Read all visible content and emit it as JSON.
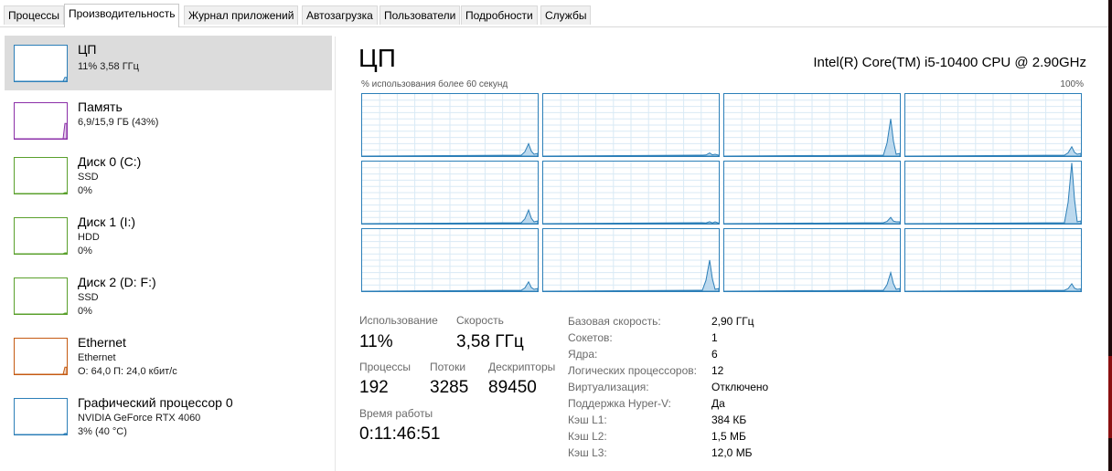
{
  "tabs": [
    "Процессы",
    "Производительность",
    "Журнал приложений",
    "Автозагрузка",
    "Пользователи",
    "Подробности",
    "Службы"
  ],
  "active_tab": "Производительность",
  "sidebar": {
    "items": [
      {
        "title": "ЦП",
        "lines": [
          "11% 3,58 ГГц"
        ],
        "color": "#2c7fb8",
        "level": 0.11
      },
      {
        "title": "Память",
        "lines": [
          "6,9/15,9 ГБ (43%)"
        ],
        "color": "#8b2fa8",
        "level": 0.43
      },
      {
        "title": "Диск 0 (C:)",
        "lines": [
          "SSD",
          "0%"
        ],
        "color": "#5aa02c",
        "level": 0
      },
      {
        "title": "Диск 1 (I:)",
        "lines": [
          "HDD",
          "0%"
        ],
        "color": "#5aa02c",
        "level": 0
      },
      {
        "title": "Диск 2 (D: F:)",
        "lines": [
          "SSD",
          "0%"
        ],
        "color": "#5aa02c",
        "level": 0
      },
      {
        "title": "Ethernet",
        "lines": [
          "Ethernet",
          "О: 64,0 П: 24,0 кбит/с"
        ],
        "color": "#c55a11",
        "level": 0.2
      },
      {
        "title": "Графический процессор 0",
        "lines": [
          "NVIDIA GeForce RTX 4060",
          "3% (40 °C)"
        ],
        "color": "#2c7fb8",
        "level": 0.03
      }
    ]
  },
  "main": {
    "title": "ЦП",
    "cpu_model": "Intel(R) Core(TM) i5-10400 CPU @ 2.90GHz",
    "graph_label": "% использования более 60 секунд",
    "graph_max": "100%",
    "core_peaks": [
      0.2,
      0.05,
      0.6,
      0.15,
      0.22,
      0.03,
      0.1,
      0.98,
      0.15,
      0.5,
      0.3,
      0.12
    ]
  },
  "stats": {
    "usage_label": "Использование",
    "usage_value": "11%",
    "speed_label": "Скорость",
    "speed_value": "3,58 ГГц",
    "processes_label": "Процессы",
    "processes_value": "192",
    "threads_label": "Потоки",
    "threads_value": "3285",
    "handles_label": "Дескрипторы",
    "handles_value": "89450",
    "uptime_label": "Время работы",
    "uptime_value": "0:11:46:51"
  },
  "specs": [
    {
      "label": "Базовая скорость:",
      "value": "2,90 ГГц"
    },
    {
      "label": "Сокетов:",
      "value": "1"
    },
    {
      "label": "Ядра:",
      "value": "6"
    },
    {
      "label": "Логических процессоров:",
      "value": "12"
    },
    {
      "label": "Виртуализация:",
      "value": "Отключено"
    },
    {
      "label": "Поддержка Hyper-V:",
      "value": "Да"
    },
    {
      "label": "Кэш L1:",
      "value": "384 КБ"
    },
    {
      "label": "Кэш L2:",
      "value": "1,5 МБ"
    },
    {
      "label": "Кэш L3:",
      "value": "12,0 МБ"
    }
  ]
}
